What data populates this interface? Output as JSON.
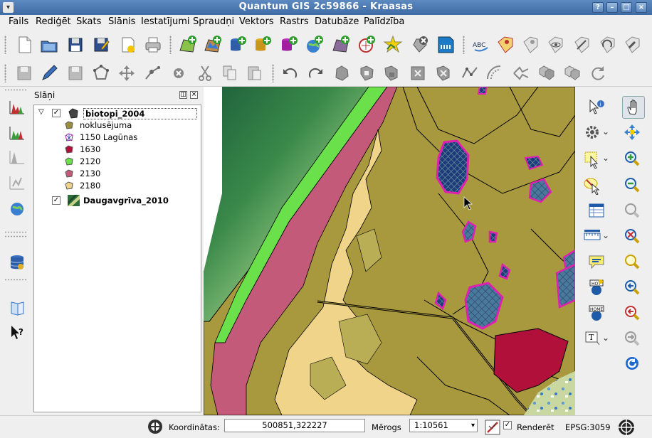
{
  "window": {
    "title": "Quantum GIS 2c59866 - Kraasas"
  },
  "menu": [
    "Fails",
    "Rediģēt",
    "Skats",
    "Slānis",
    "Iestatījumi",
    "Spraudņi",
    "Vektors",
    "Rastrs",
    "Datubāze",
    "Palīdzība"
  ],
  "layers_panel": {
    "title": "Slāņi",
    "layers": [
      {
        "name": "biotopi_2004",
        "checked": true,
        "expanded": true,
        "legend": [
          {
            "label": "noklusējuma",
            "color": "#9c8e3a"
          },
          {
            "label": "1150 Lagūnas",
            "color": "#3a3aa8"
          },
          {
            "label": "1630",
            "color": "#b0103a"
          },
          {
            "label": "2120",
            "color": "#6ae04a"
          },
          {
            "label": "2130",
            "color": "#c45a7a"
          },
          {
            "label": "2180",
            "color": "#efd48a"
          }
        ]
      },
      {
        "name": "Daugavgrīva_2010",
        "checked": true
      }
    ]
  },
  "statusbar": {
    "coords_label": "Koordinātas:",
    "coords_value": "500851,322227",
    "scale_label": "Mērogs",
    "scale_value": "1:10561",
    "render_label": "Renderēt",
    "render_checked": true,
    "crs": "EPSG:3059"
  },
  "colors": {
    "titlebar": "#4a78b0",
    "map_background": "#a8993f",
    "dune_2130": "#c45a7a",
    "dune_2120": "#6ae04a",
    "dune_2180": "#efd48a",
    "habitat_1630": "#b0103a",
    "lagoon_1150": "#2b3f7a",
    "outline": "#e020b0"
  }
}
